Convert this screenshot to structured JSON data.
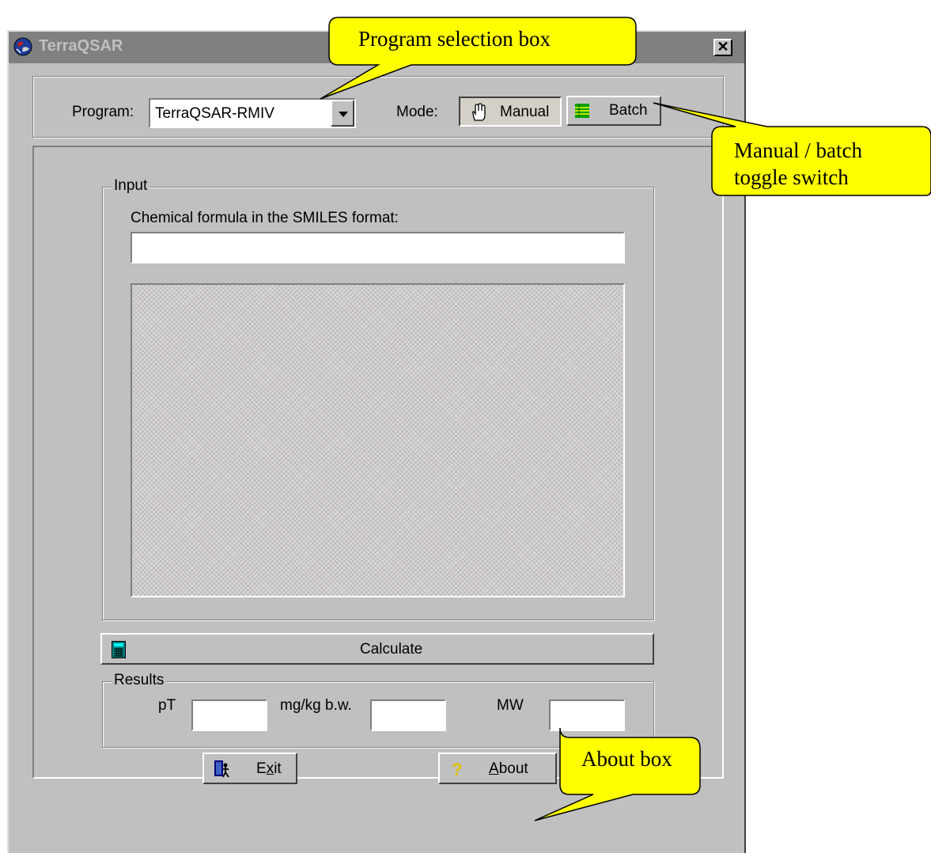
{
  "window": {
    "title": "TerraQSAR",
    "close_glyph": "✕"
  },
  "toolbar": {
    "program_label": "Program:",
    "program_value": "TerraQSAR-RMIV",
    "mode_label": "Mode:",
    "manual_label": "Manual",
    "batch_label": "Batch"
  },
  "input": {
    "legend": "Input",
    "smiles_label": "Chemical formula in the SMILES format:",
    "smiles_value": ""
  },
  "calculate_label": "Calculate",
  "results": {
    "legend": "Results",
    "pt_label": "pT",
    "mgkg_label": "mg/kg b.w.",
    "mw_label": "MW",
    "pt_value": "",
    "mgkg_value": "",
    "mw_value": ""
  },
  "footer": {
    "exit_prefix": "E",
    "exit_underline": "x",
    "exit_suffix": "it",
    "about_underline": "A",
    "about_suffix": "bout"
  },
  "callouts": {
    "program": "Program selection box",
    "mode_line1": "Manual / batch",
    "mode_line2": "toggle switch",
    "about": "About box"
  },
  "colors": {
    "callout_fill": "#ffff00",
    "titlebar_inactive": "#808080",
    "face": "#c0c0c0"
  },
  "icons": [
    "app-globe-icon",
    "dropdown-arrow-icon",
    "hand-icon",
    "batch-grid-icon",
    "calculator-icon",
    "exit-door-icon",
    "question-mark-icon"
  ]
}
